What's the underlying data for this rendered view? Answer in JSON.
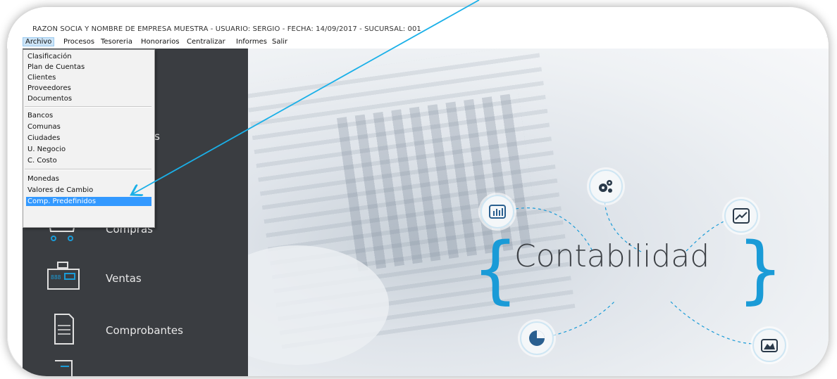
{
  "window": {
    "title": "RAZON SOCIA Y NOMBRE DE EMPRESA MUESTRA - USUARIO: SERGIO - FECHA: 14/09/2017 - SUCURSAL: 001"
  },
  "menubar": {
    "items": [
      "Archivo",
      "Procesos",
      "Tesoreria",
      "Honorarios",
      "Centralizar",
      "Informes",
      "Salir"
    ]
  },
  "archivo_menu": {
    "group1": [
      "Clasificación",
      "Plan de Cuentas",
      "Clientes",
      "Proveedores",
      "Documentos"
    ],
    "group2": [
      "Bancos",
      "Comunas",
      "Ciudades",
      "U. Negocio",
      "C. Costo"
    ],
    "group3": [
      "Monedas",
      "Valores de Cambio",
      "Comp. Predefinidos"
    ],
    "selected": "Comp. Predefinidos"
  },
  "sidebar": {
    "items": [
      {
        "label": "res",
        "icon": "people-icon"
      },
      {
        "label": "Compras",
        "icon": "cart-icon"
      },
      {
        "label": "Ventas",
        "icon": "cash-register-icon"
      },
      {
        "label": "Comprobantes",
        "icon": "document-icon"
      },
      {
        "label": "",
        "icon": "ledger-icon"
      }
    ]
  },
  "hero": {
    "heading": "Contabilidad",
    "icons": [
      "bar-chart-icon",
      "gears-icon",
      "line-chart-icon",
      "pie-chart-icon",
      "area-chart-icon"
    ]
  },
  "colors": {
    "accent": "#1a9bd7",
    "sidebar": "#3a3d41",
    "menu_selected": "#3399ff",
    "annotation_arrow": "#1ab0e8"
  }
}
